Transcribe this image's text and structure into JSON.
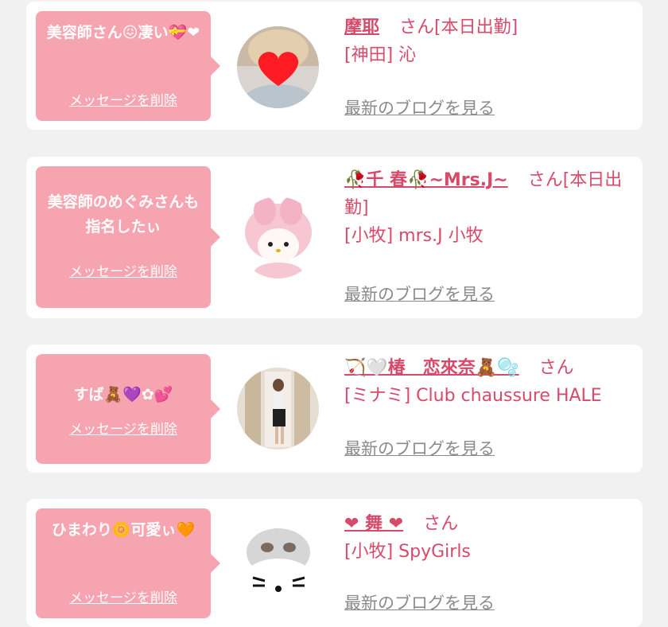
{
  "items": [
    {
      "message": "美容師さん😖凄い💝❤",
      "delete_label": "メッセージを削除",
      "name": "摩耶",
      "suffix": "さん[本日出勤]",
      "shop": "[神田] 沁",
      "blog_label": "最新のブログを見る"
    },
    {
      "message": "美容師のめぐみさんも指名したぃ",
      "delete_label": "メッセージを削除",
      "name": "🥀千 春🥀~Mrs.J~",
      "suffix": "さん[本日出勤]",
      "shop": "[小牧] mrs.J 小牧",
      "blog_label": "最新のブログを見る"
    },
    {
      "message": "すば🧸💜✿💕",
      "delete_label": "メッセージを削除",
      "name": "🏹🤍椿　恋來奈🧸🫧",
      "suffix": "さん",
      "shop": "[ミナミ] Club chaussure HALE",
      "blog_label": "最新のブログを見る"
    },
    {
      "message": "ひまわり🌼可愛ぃ🧡",
      "delete_label": "メッセージを削除",
      "name": "❤ 舞 ❤",
      "suffix": "さん",
      "shop": "[小牧] SpyGirls",
      "blog_label": "最新のブログを見る"
    }
  ],
  "colors": {
    "bubble": "#f7a4b1",
    "accent": "#d84a6a",
    "link_gray": "#8a8a8a",
    "background": "#f1f1f1"
  }
}
